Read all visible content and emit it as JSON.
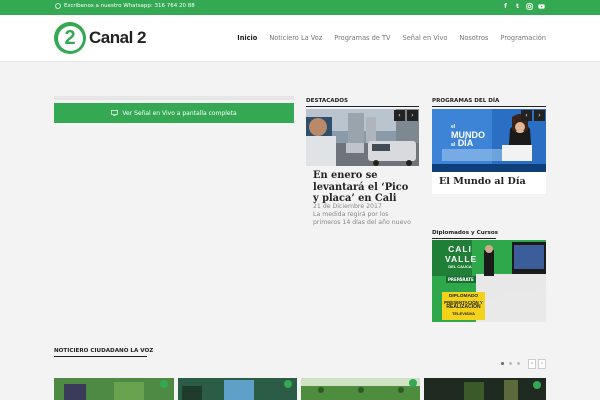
{
  "topbar": {
    "whatsapp_text": "Escribenos a nuestro Whatsapp: 316 764 20 88",
    "social": [
      "facebook-icon",
      "twitter-icon",
      "instagram-icon",
      "youtube-icon"
    ]
  },
  "logo": {
    "number": "2",
    "name": "Canal 2"
  },
  "nav": [
    {
      "label": "Inicio",
      "active": true
    },
    {
      "label": "Noticiero La Voz"
    },
    {
      "label": "Programas de TV"
    },
    {
      "label": "Señal en Vivo"
    },
    {
      "label": "Nosotros"
    },
    {
      "label": "Programación"
    }
  ],
  "live": {
    "button_label": "Ver Señal en Vivo a pantalla completa"
  },
  "featured": {
    "heading": "DESTACADOS",
    "title": "En enero se levantará el ‘Pico y placa’ en Cali",
    "date": "21 de Diciembre 2017",
    "description": "La medida regirá por los primeros 14 días del año nuevo"
  },
  "programs": {
    "heading": "PROGRAMAS DEL DÍA",
    "title": "El Mundo al Día",
    "image_text": {
      "line1": "MUNDO",
      "line2": "DÍA",
      "prefix": "el",
      "prefix2": "al"
    }
  },
  "diplomados": {
    "heading": "Diplomados y Cursos",
    "poster": {
      "line1": "CALI",
      "line2": "VALLE",
      "line3": "DEL CAUCA",
      "badge": "PREPÁRATE",
      "l1": "DIPLOMADO",
      "l2": "PRESENTACIÓN Y",
      "l3": "REALIZACIÓN",
      "l4": "TELEVISIVA"
    }
  },
  "citizen_news": {
    "heading": "NOTICIERO CIUDADANO LA VOZ",
    "prev": "‹",
    "next": "›"
  },
  "colors": {
    "brand": "#34a853",
    "dark": "#222222"
  }
}
